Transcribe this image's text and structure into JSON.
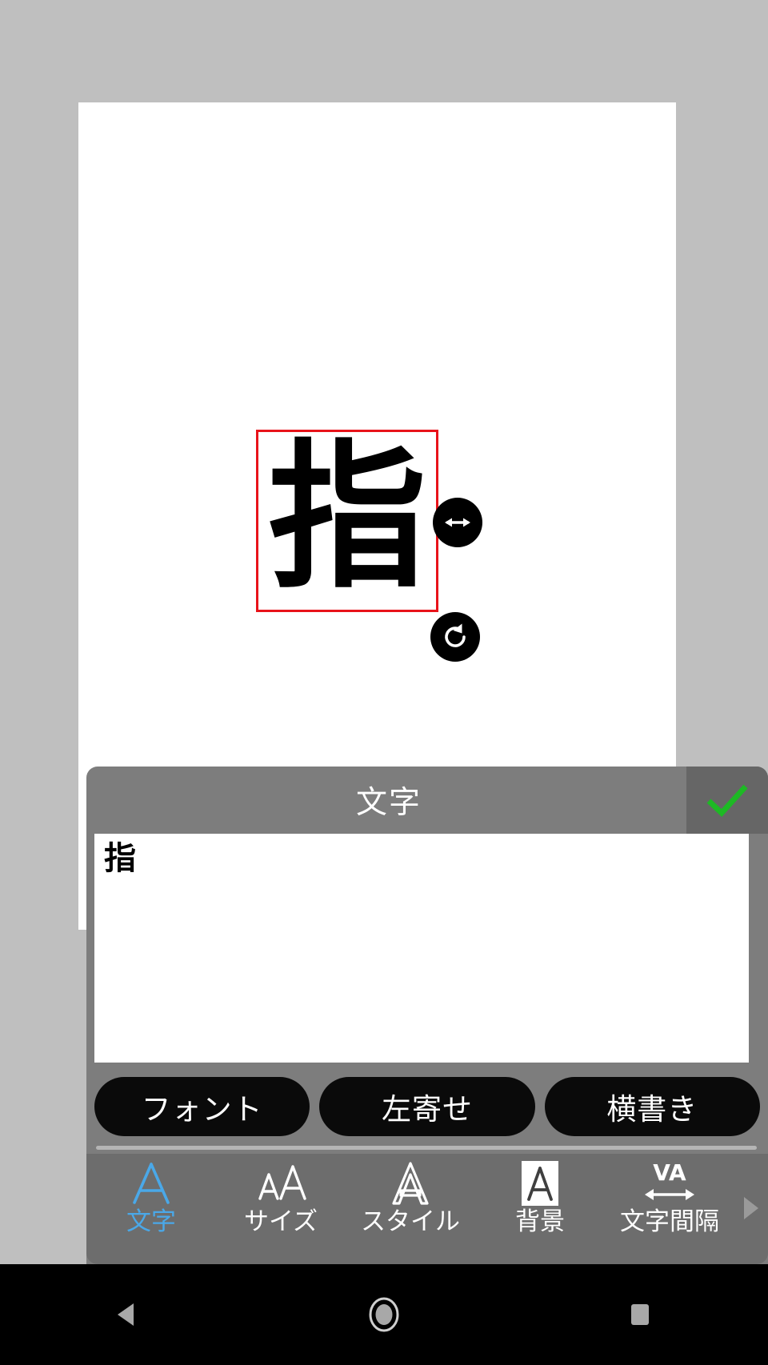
{
  "canvas": {
    "text_object": {
      "content": "指",
      "selection_border_color": "#e8131a",
      "handles": [
        {
          "name": "resize-handle",
          "icon": "horizontal-arrows-icon"
        },
        {
          "name": "rotate-handle",
          "icon": "rotate-counterclockwise-icon"
        }
      ]
    },
    "page_background": "#ffffff",
    "app_background": "#bfbfbf"
  },
  "panel": {
    "title": "文字",
    "confirm": {
      "label": "✓",
      "icon": "checkmark-icon",
      "color": "#1db924"
    },
    "text_input": {
      "value": "指",
      "placeholder": ""
    },
    "options": [
      {
        "label": "フォント",
        "name": "font-button"
      },
      {
        "label": "左寄せ",
        "name": "align-button"
      },
      {
        "label": "横書き",
        "name": "writing-direction-button"
      }
    ],
    "tabs": [
      {
        "label": "文字",
        "icon": "letter-a-outline-icon",
        "icon_text": "A",
        "active": true
      },
      {
        "label": "サイズ",
        "icon": "size-aa-icon",
        "icon_text": "AA",
        "active": false
      },
      {
        "label": "スタイル",
        "icon": "letter-a-hollow-icon",
        "icon_text": "A",
        "active": false
      },
      {
        "label": "背景",
        "icon": "letter-a-on-box-icon",
        "icon_text": "A",
        "active": false
      },
      {
        "label": "文字間隔",
        "icon": "letter-spacing-va-icon",
        "icon_text": "VA",
        "active": false
      }
    ],
    "scroll_arrow": {
      "name": "tab-scroll-right",
      "icon": "triangle-right-icon"
    },
    "accent_color": "#4aa8e8",
    "panel_background": "#7d7d7d",
    "tabbar_background": "#6d6d6d"
  },
  "navbar": {
    "buttons": [
      {
        "name": "back-button",
        "icon": "triangle-left-icon"
      },
      {
        "name": "home-button",
        "icon": "circle-icon"
      },
      {
        "name": "recents-button",
        "icon": "square-icon"
      }
    ]
  }
}
